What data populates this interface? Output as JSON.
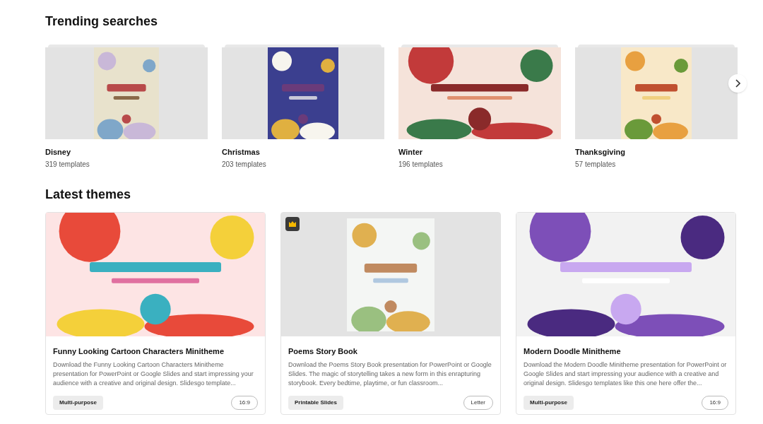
{
  "trending": {
    "title": "Trending searches",
    "items": [
      {
        "name": "Disney",
        "count": "319 templates"
      },
      {
        "name": "Christmas",
        "count": "203 templates"
      },
      {
        "name": "Winter",
        "count": "196 templates"
      },
      {
        "name": "Thanksgiving",
        "count": "57 templates"
      }
    ]
  },
  "latest": {
    "title": "Latest themes",
    "items": [
      {
        "title": "Funny Looking Cartoon Characters Minitheme",
        "description": "Download the Funny Looking Cartoon Characters Minitheme presentation for PowerPoint or Google Slides and start impressing your audience with a creative and original design. Slidesgo template...",
        "tag": "Multi-purpose",
        "format": "16:9",
        "premium": false
      },
      {
        "title": "Poems Story Book",
        "description": "Download the Poems Story Book presentation for PowerPoint or Google Slides. The magic of storytelling takes a new form in this enrapturing storybook. Every bedtime, playtime, or fun classroom...",
        "tag": "Printable Slides",
        "format": "Letter",
        "premium": true
      },
      {
        "title": "Modern Doodle Minitheme",
        "description": "Download the Modern Doodle Minitheme presentation for PowerPoint or Google Slides and start impressing your audience with a creative and original design. Slidesgo templates like this one here offer the...",
        "tag": "Multi-purpose",
        "format": "16:9",
        "premium": false
      }
    ]
  }
}
